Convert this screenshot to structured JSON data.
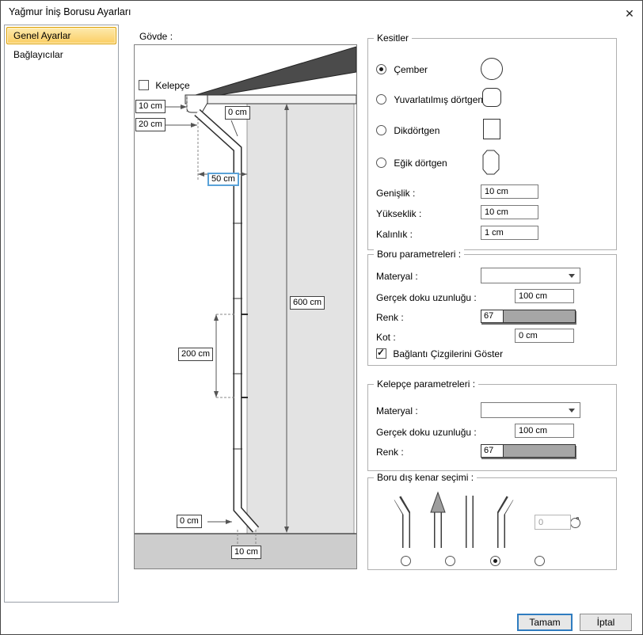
{
  "window": {
    "title": "Yağmur İniş Borusu Ayarları",
    "close": "✕"
  },
  "sidebar": {
    "items": [
      {
        "label": "Genel Ayarlar",
        "selected": true
      },
      {
        "label": "Bağlayıcılar",
        "selected": false
      }
    ]
  },
  "drawing": {
    "section_label": "Gövde :",
    "kelepce_label": "Kelepçe",
    "kelepce_checked": false,
    "dims": {
      "gutter_height": "10 cm",
      "gutter_depth": "20 cm",
      "top_offset": "0 cm",
      "gutter_width": "50 cm",
      "wall_height": "600 cm",
      "clamp_spacing": "200 cm",
      "bottom_offset": "0 cm",
      "outlet_length": "10 cm"
    }
  },
  "kesitler": {
    "title": "Kesitler",
    "options": [
      {
        "label": "Çember",
        "selected": true
      },
      {
        "label": "Yuvarlatılmış dörtgen",
        "selected": false
      },
      {
        "label": "Dikdörtgen",
        "selected": false
      },
      {
        "label": "Eğik dörtgen",
        "selected": false
      }
    ],
    "fields": [
      {
        "label": "Genişlik :",
        "value": "10 cm"
      },
      {
        "label": "Yükseklik :",
        "value": "10 cm"
      },
      {
        "label": "Kalınlık :",
        "value": "1 cm"
      }
    ]
  },
  "boru": {
    "title": "Boru parametreleri :",
    "materyal_label": "Materyal :",
    "materyal_value": "",
    "doku_label": "Gerçek doku uzunluğu :",
    "doku_value": "100 cm",
    "renk_label": "Renk :",
    "renk_value": "67",
    "kot_label": "Kot :",
    "kot_value": "0 cm",
    "baglanti_label": "Bağlantı Çizgilerini Göster",
    "baglanti_checked": true
  },
  "kelepce": {
    "title": "Kelepçe parametreleri :",
    "materyal_label": "Materyal :",
    "materyal_value": "",
    "doku_label": "Gerçek doku uzunluğu :",
    "doku_value": "100 cm",
    "renk_label": "Renk :",
    "renk_value": "67"
  },
  "kenar": {
    "title": "Boru dış kenar seçimi :",
    "options": [
      {
        "selected": false
      },
      {
        "selected": false
      },
      {
        "selected": true
      },
      {
        "selected": false
      }
    ],
    "angle_selected": false,
    "angle_value": "0",
    "degree": "°"
  },
  "footer": {
    "ok": "Tamam",
    "cancel": "İptal"
  },
  "colors": {
    "renk_swatch": "#a6a6a6",
    "selection_orange": "#dd9f00",
    "focus_blue": "#5aa2d8"
  }
}
